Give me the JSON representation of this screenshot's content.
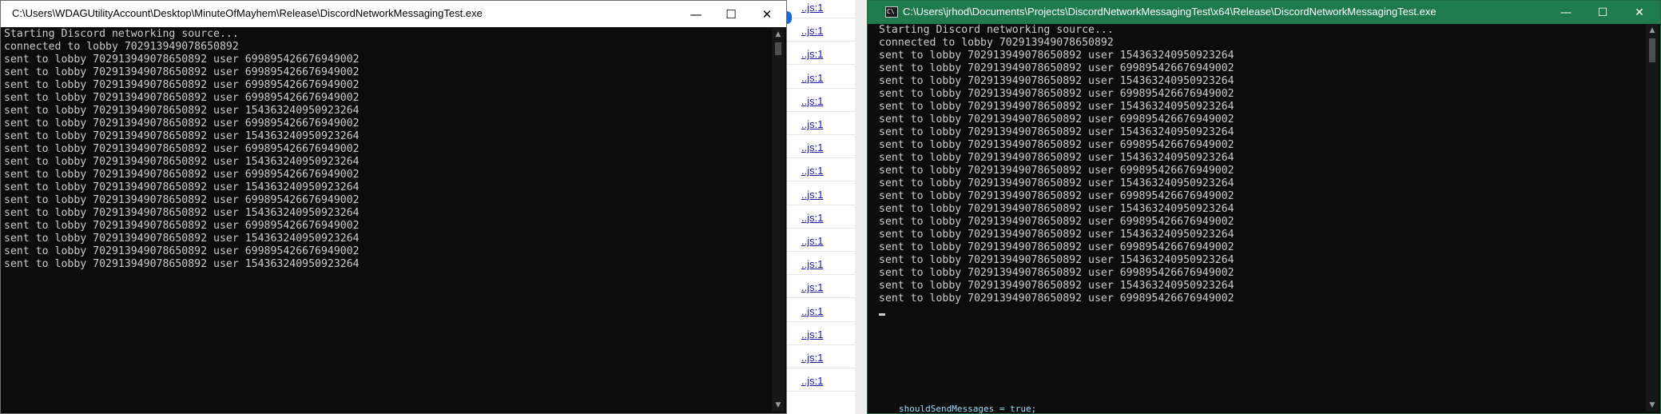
{
  "left_window": {
    "title": "C:\\Users\\WDAGUtilityAccount\\Desktop\\MinuteOfMayhem\\Release\\DiscordNetworkMessagingTest.exe",
    "controls": {
      "minimize": "—",
      "maximize": "☐",
      "close": "✕"
    },
    "lines": [
      "Starting Discord networking source...",
      "connected to lobby 702913949078650892",
      "sent to lobby 702913949078650892 user 699895426676949002",
      "sent to lobby 702913949078650892 user 699895426676949002",
      "sent to lobby 702913949078650892 user 699895426676949002",
      "sent to lobby 702913949078650892 user 699895426676949002",
      "sent to lobby 702913949078650892 user 154363240950923264",
      "sent to lobby 702913949078650892 user 699895426676949002",
      "sent to lobby 702913949078650892 user 154363240950923264",
      "sent to lobby 702913949078650892 user 699895426676949002",
      "sent to lobby 702913949078650892 user 154363240950923264",
      "sent to lobby 702913949078650892 user 699895426676949002",
      "sent to lobby 702913949078650892 user 154363240950923264",
      "sent to lobby 702913949078650892 user 699895426676949002",
      "sent to lobby 702913949078650892 user 154363240950923264",
      "sent to lobby 702913949078650892 user 699895426676949002",
      "sent to lobby 702913949078650892 user 154363240950923264",
      "sent to lobby 702913949078650892 user 699895426676949002",
      "sent to lobby 702913949078650892 user 154363240950923264"
    ]
  },
  "background_editor": {
    "link_text": "..js:1",
    "link_count": 17,
    "code_peek": "shouldSendMessages = true;"
  },
  "right_window": {
    "title": "C:\\Users\\jrhod\\Documents\\Projects\\DiscordNetworkMessagingTest\\x64\\Release\\DiscordNetworkMessagingTest.exe",
    "icon_text": "C\\",
    "controls": {
      "minimize": "—",
      "maximize": "☐",
      "close": "✕"
    },
    "lines": [
      "Starting Discord networking source...",
      "connected to lobby 702913949078650892",
      "sent to lobby 702913949078650892 user 154363240950923264",
      "sent to lobby 702913949078650892 user 699895426676949002",
      "sent to lobby 702913949078650892 user 154363240950923264",
      "sent to lobby 702913949078650892 user 699895426676949002",
      "sent to lobby 702913949078650892 user 154363240950923264",
      "sent to lobby 702913949078650892 user 699895426676949002",
      "sent to lobby 702913949078650892 user 154363240950923264",
      "sent to lobby 702913949078650892 user 699895426676949002",
      "sent to lobby 702913949078650892 user 154363240950923264",
      "sent to lobby 702913949078650892 user 699895426676949002",
      "sent to lobby 702913949078650892 user 154363240950923264",
      "sent to lobby 702913949078650892 user 699895426676949002",
      "sent to lobby 702913949078650892 user 154363240950923264",
      "sent to lobby 702913949078650892 user 699895426676949002",
      "sent to lobby 702913949078650892 user 154363240950923264",
      "sent to lobby 702913949078650892 user 699895426676949002",
      "sent to lobby 702913949078650892 user 154363240950923264",
      "sent to lobby 702913949078650892 user 699895426676949002",
      "sent to lobby 702913949078650892 user 154363240950923264",
      "sent to lobby 702913949078650892 user 699895426676949002"
    ]
  }
}
